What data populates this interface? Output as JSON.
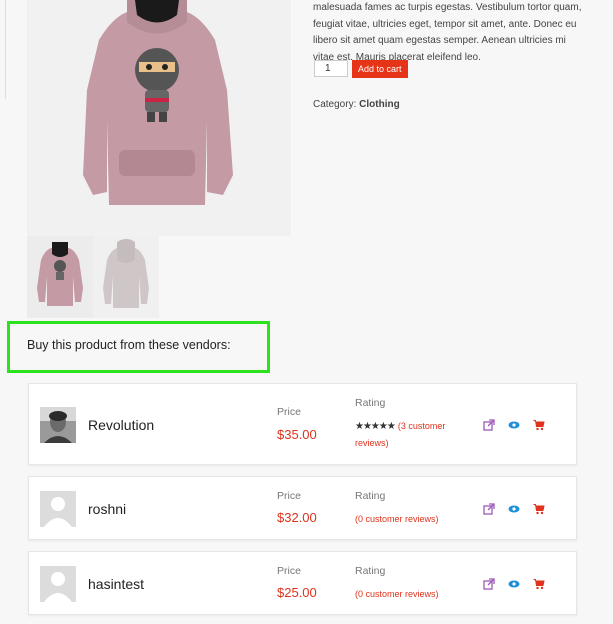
{
  "product": {
    "description": "malesuada fames ac turpis egestas. Vestibulum tortor quam, feugiat vitae, ultricies eget, tempor sit amet, ante. Donec eu libero sit amet quam egestas semper. Aenean ultricies mi vitae est. Mauris placerat eleifend leo.",
    "quantity": "1",
    "add_to_cart_label": "Add to cart",
    "category_label": "Category:",
    "category_value": "Clothing"
  },
  "vendors": {
    "heading": "Buy this product from these vendors:",
    "price_label": "Price",
    "rating_label": "Rating",
    "list": [
      {
        "name": "Revolution",
        "price": "$35.00",
        "reviews": "(3 customer reviews)",
        "stars": 5,
        "avatar": "photo"
      },
      {
        "name": "roshni",
        "price": "$32.00",
        "reviews": "(0 customer reviews)",
        "stars": 0,
        "avatar": "placeholder"
      },
      {
        "name": "hasintest",
        "price": "$25.00",
        "reviews": "(0 customer reviews)",
        "stars": 0,
        "avatar": "placeholder"
      }
    ]
  },
  "icons": {
    "external_link": "external-link-icon",
    "view": "eye-icon",
    "cart": "cart-icon"
  },
  "colors": {
    "accent": "#e0321c",
    "add_to_cart_bg": "#e53418",
    "highlight_box": "#2be31c",
    "link_icon": "#9b59b6",
    "eye_icon": "#1e8fd8"
  }
}
